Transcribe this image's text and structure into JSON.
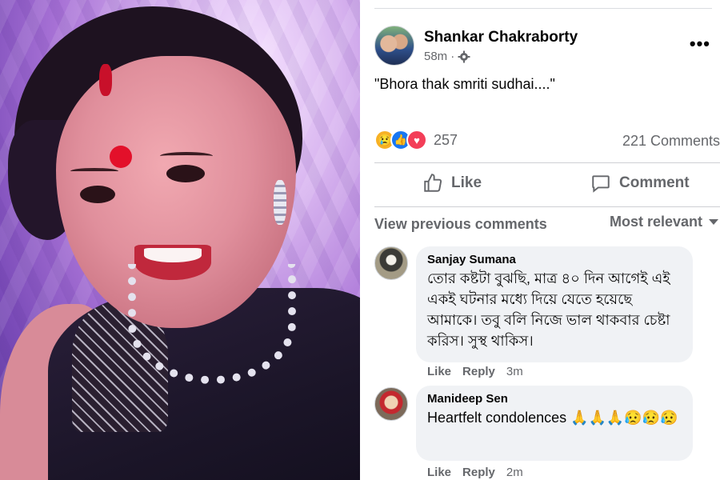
{
  "post": {
    "author": "Shankar Chakraborty",
    "time": "58m",
    "separator": "·",
    "text": "\"Bhora thak smriti sudhai....\"",
    "more_label": "•••",
    "reaction_count": "257",
    "comment_count": "221 Comments",
    "reaction_icons": [
      "sad-reaction-icon",
      "like-reaction-icon",
      "love-reaction-icon"
    ]
  },
  "actions": {
    "like_label": "Like",
    "comment_label": "Comment"
  },
  "comments_bar": {
    "view_previous": "View previous comments",
    "sort_label": "Most relevant"
  },
  "comments": [
    {
      "author": "Sanjay Sumana",
      "text": "তোর কষ্টটা বুঝছি, মাত্র ৪০ দিন আগেই এই একই ঘটনার মধ্যে দিয়ে যেতে হয়েছে আমাকে। তবু বলি নিজে ভাল থাকবার চেষ্টা করিস। সুস্থ থাকিস।",
      "like_label": "Like",
      "reply_label": "Reply",
      "time": "3m"
    },
    {
      "author": "Manideep Sen",
      "text": "Heartfelt condolences 🙏🙏🙏😥😥😥",
      "like_label": "Like",
      "reply_label": "Reply",
      "time": "2m"
    }
  ],
  "colors": {
    "text_primary": "#050505",
    "text_secondary": "#65676b",
    "bubble_bg": "#f0f2f5",
    "divider": "#ced0d4",
    "like_blue": "#1877f2",
    "love_red": "#f33e58",
    "sad_yellow": "#f7b125"
  }
}
